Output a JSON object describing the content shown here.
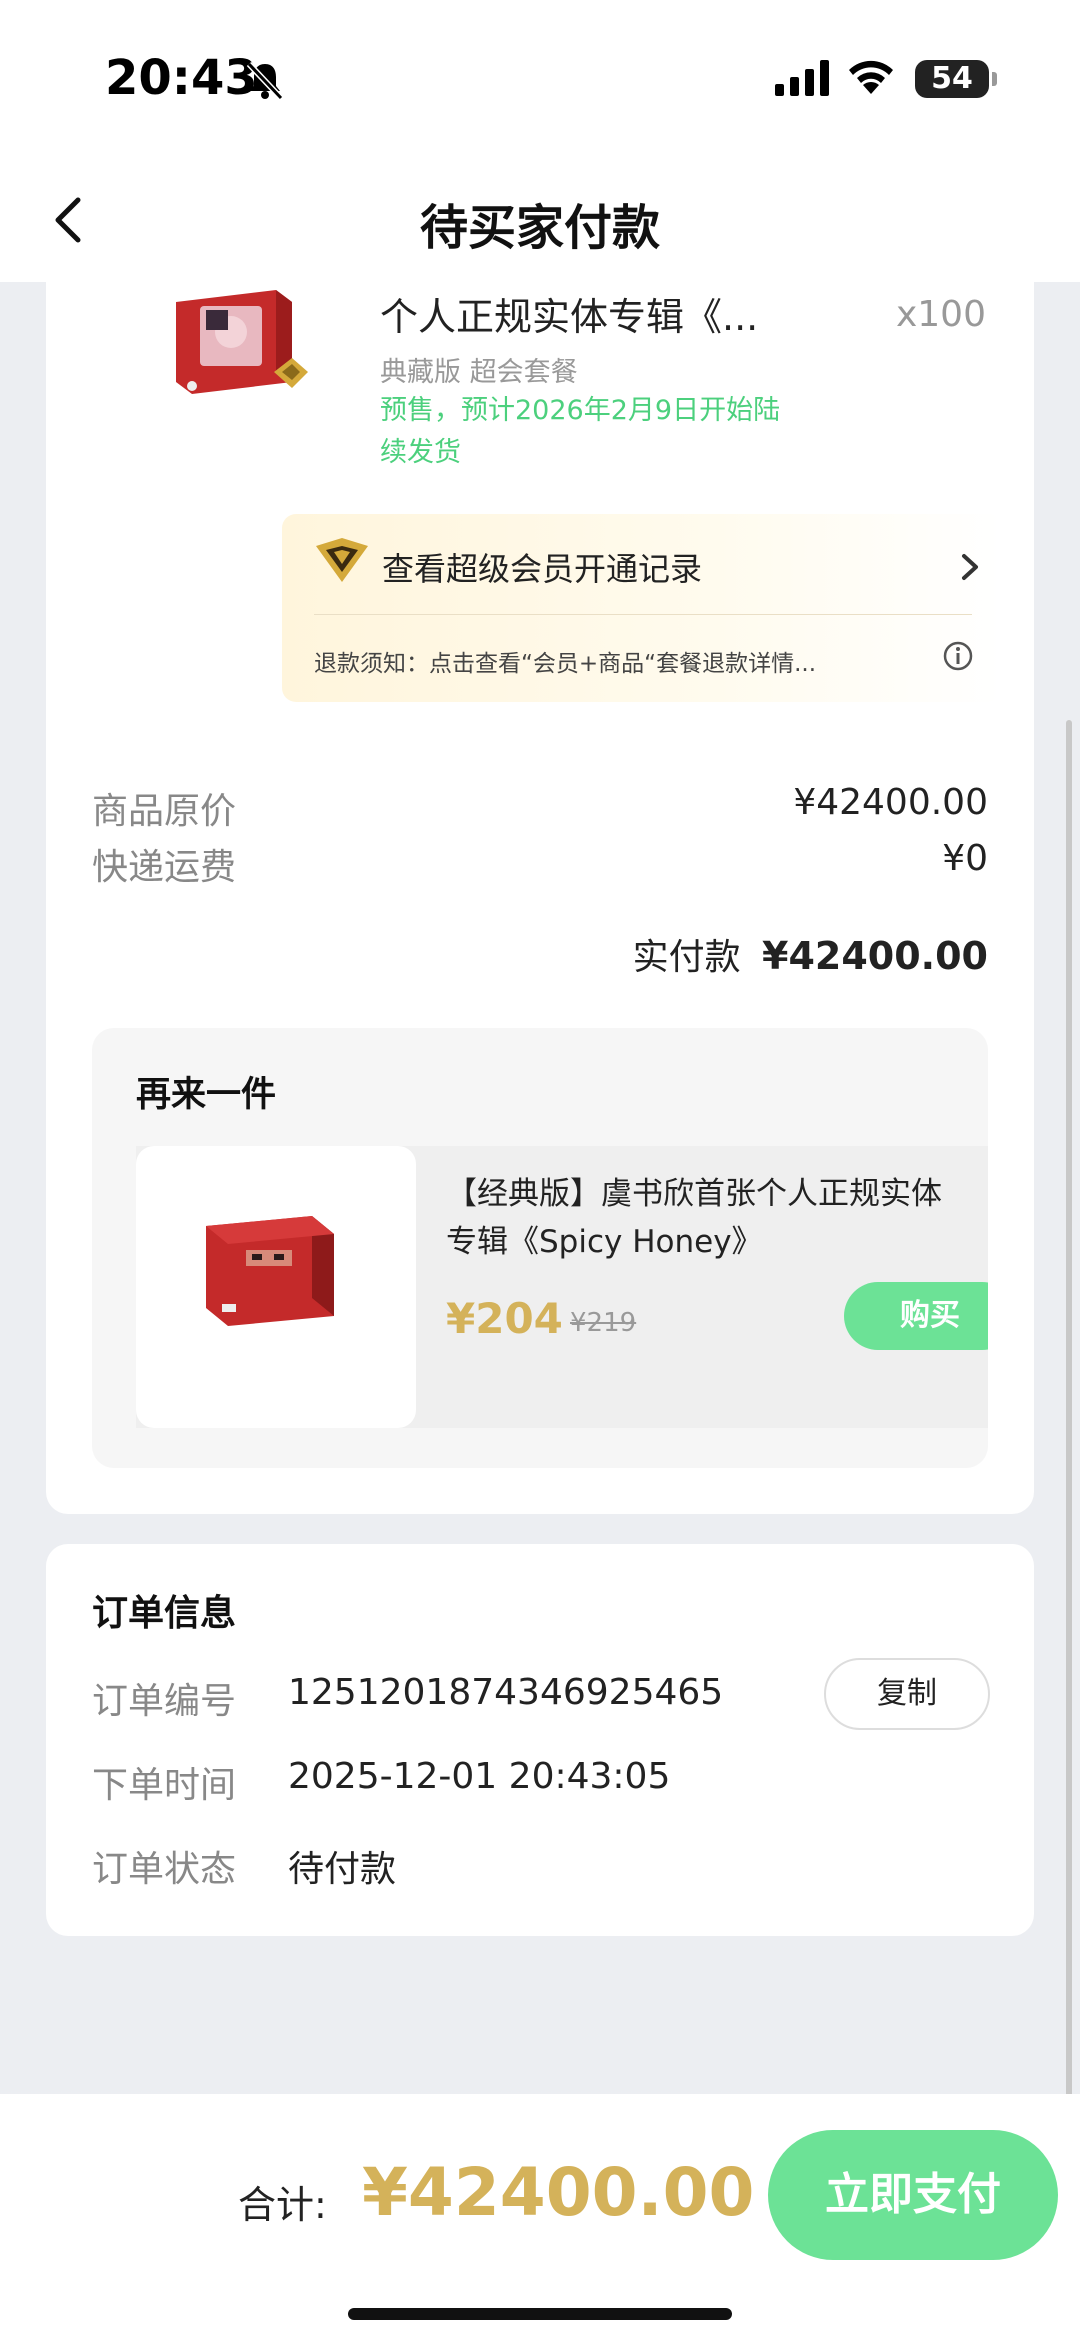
{
  "status_bar": {
    "time": "20:43",
    "battery": "54"
  },
  "header": {
    "title": "待买家付款"
  },
  "product": {
    "title": "个人正规实体专辑《...",
    "quantity": "x100",
    "spec": "典藏版 超会套餐",
    "presale": "预售，预计2026年2月9日开始陆续发货"
  },
  "vip": {
    "label": "查看超级会员开通记录",
    "refund_note": "退款须知：点击查看“会员+商品“套餐退款详情..."
  },
  "prices": {
    "original_label": "商品原价",
    "original_value": "¥42400.00",
    "shipping_label": "快递运费",
    "shipping_value": "¥0",
    "paid_label": "实付款",
    "paid_value": "¥42400.00"
  },
  "again": {
    "title": "再来一件",
    "item_name": "【经典版】虞书欣首张个人正规实体专辑《Spicy Honey》",
    "price": "¥204",
    "old_price": "¥219",
    "buy_label": "购买"
  },
  "order": {
    "title": "订单信息",
    "number_label": "订单编号",
    "number_value": "1251201874346925465",
    "copy_label": "复制",
    "time_label": "下单时间",
    "time_value": "2025-12-01 20:43:05",
    "status_label": "订单状态",
    "status_value": "待付款"
  },
  "bottom": {
    "total_label": "合计:",
    "total_amount": "¥42400.00",
    "pay_label": "立即支付"
  },
  "colors": {
    "accent_green": "#6ce296",
    "presale_green": "#4cd07d",
    "gold": "#d4b25a"
  }
}
